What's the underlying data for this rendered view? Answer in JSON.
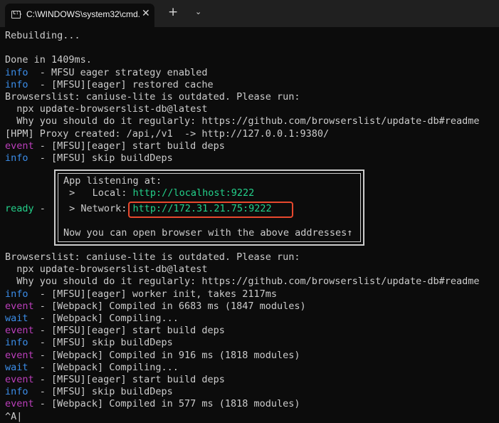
{
  "window": {
    "tab_title": "C:\\WINDOWS\\system32\\cmd.",
    "tab_icon": "console-icon",
    "close_glyph": "✕",
    "new_tab_glyph": "+",
    "dropdown_glyph": "⌄"
  },
  "colors": {
    "background": "#0c0c0c",
    "text": "#cccccc",
    "info": "#3b8eea",
    "event": "#bc3fbc",
    "wait": "#3b8eea",
    "ready": "#23d18b",
    "url": "#23d18b",
    "highlight": "#e8482e"
  },
  "lines_top": [
    {
      "text": "Rebuilding..."
    },
    {
      "text": ""
    },
    {
      "text": "Done in 1409ms."
    },
    {
      "prefix": "info",
      "text": "  - MFSU eager strategy enabled"
    },
    {
      "prefix": "info",
      "text": "  - [MFSU][eager] restored cache"
    },
    {
      "text": "Browserslist: caniuse-lite is outdated. Please run:"
    },
    {
      "text": "  npx update-browserslist-db@latest"
    },
    {
      "text": "  Why you should do it regularly: https://github.com/browserslist/update-db#readme"
    },
    {
      "text": "[HPM] Proxy created: /api,/v1  -> http://127.0.0.1:9380/"
    },
    {
      "prefix": "event",
      "text": " - [MFSU][eager] start build deps"
    },
    {
      "prefix": "info",
      "text": "  - [MFSU] skip buildDeps"
    }
  ],
  "ready_block": {
    "prefix": "ready",
    "dash": " -",
    "heading": "App listening at:",
    "local_label": " >   Local: ",
    "local_url": "http://localhost:9222",
    "network_label": " > Network: ",
    "network_url": "http://172.31.21.75:9222",
    "footer": "Now you can open browser with the above addresses↑"
  },
  "lines_bottom": [
    {
      "text": "Browserslist: caniuse-lite is outdated. Please run:"
    },
    {
      "text": "  npx update-browserslist-db@latest"
    },
    {
      "text": "  Why you should do it regularly: https://github.com/browserslist/update-db#readme"
    },
    {
      "prefix": "info",
      "text": "  - [MFSU][eager] worker init, takes 2117ms"
    },
    {
      "prefix": "event",
      "text": " - [Webpack] Compiled in 6683 ms (1847 modules)"
    },
    {
      "prefix": "wait",
      "text": "  - [Webpack] Compiling..."
    },
    {
      "prefix": "event",
      "text": " - [MFSU][eager] start build deps"
    },
    {
      "prefix": "info",
      "text": "  - [MFSU] skip buildDeps"
    },
    {
      "prefix": "event",
      "text": " - [Webpack] Compiled in 916 ms (1818 modules)"
    },
    {
      "prefix": "wait",
      "text": "  - [Webpack] Compiling..."
    },
    {
      "prefix": "event",
      "text": " - [MFSU][eager] start build deps"
    },
    {
      "prefix": "info",
      "text": "  - [MFSU] skip buildDeps"
    },
    {
      "prefix": "event",
      "text": " - [Webpack] Compiled in 577 ms (1818 modules)"
    },
    {
      "text": "^A|"
    }
  ]
}
